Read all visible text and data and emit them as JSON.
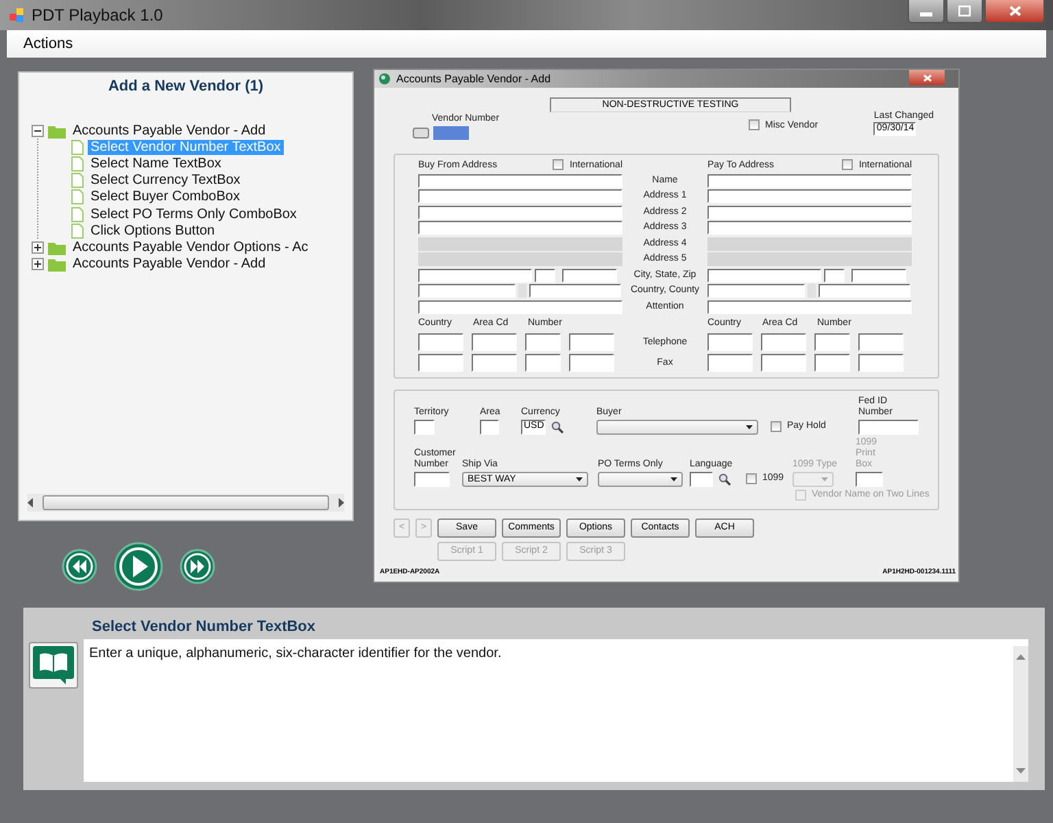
{
  "window": {
    "title": "PDT Playback 1.0"
  },
  "menu": [
    {
      "label": "Actions"
    }
  ],
  "tree_panel": {
    "title": "Add a New Vendor (1)",
    "items": [
      {
        "label": "Accounts Payable Vendor - Add",
        "expanded": true,
        "selected": false,
        "children": [
          {
            "label": "Select Vendor Number TextBox",
            "selected": true
          },
          {
            "label": "Select Name TextBox",
            "selected": false
          },
          {
            "label": "Select Currency TextBox",
            "selected": false
          },
          {
            "label": "Select Buyer ComboBox",
            "selected": false
          },
          {
            "label": "Select PO Terms Only ComboBox",
            "selected": false
          },
          {
            "label": "Click Options Button",
            "selected": false
          }
        ]
      },
      {
        "label": "Accounts Payable Vendor Options - Ac",
        "expanded": false,
        "selected": false
      },
      {
        "label": "Accounts Payable Vendor - Add",
        "expanded": false,
        "selected": false
      }
    ]
  },
  "vendor_form": {
    "title": "Accounts Payable Vendor - Add",
    "company": "NON-DESTRUCTIVE TESTING",
    "vendor_number": {
      "label": "Vendor Number"
    },
    "misc_vendor": {
      "label": "Misc Vendor",
      "checked": false
    },
    "last_changed": {
      "label": "Last Changed",
      "value": "09/30/14"
    },
    "address": {
      "left_title": "Buy From Address",
      "right_title": "Pay To Address",
      "left_international": {
        "label": "International",
        "checked": false
      },
      "right_international": {
        "label": "International",
        "checked": false
      },
      "rows": [
        {
          "label": "Name",
          "kind": "full",
          "disabled": false
        },
        {
          "label": "Address 1",
          "kind": "full",
          "disabled": false
        },
        {
          "label": "Address 2",
          "kind": "full",
          "disabled": false
        },
        {
          "label": "Address 3",
          "kind": "full",
          "disabled": false
        },
        {
          "label": "Address 4",
          "kind": "full",
          "disabled": true
        },
        {
          "label": "Address 5",
          "kind": "full",
          "disabled": true
        },
        {
          "label": "City, State, Zip",
          "kind": "city",
          "disabled": false
        },
        {
          "label": "Country, County",
          "kind": "country",
          "disabled": false
        },
        {
          "label": "Attention",
          "kind": "full",
          "disabled": false
        }
      ],
      "left_phone_columns": [
        "Country",
        "Area Cd",
        "Number"
      ],
      "right_phone_columns": [
        "Country",
        "Area Cd",
        "Number"
      ],
      "phone_rows": [
        "Telephone",
        "Fax"
      ]
    },
    "details": [
      [
        {
          "label": "Territory",
          "kind": "text"
        },
        {
          "label": "Area",
          "kind": "text"
        },
        {
          "label": "Currency",
          "kind": "lookup",
          "value": "USD"
        },
        {
          "label": "Buyer",
          "kind": "combo"
        },
        {
          "label": "Pay Hold",
          "kind": "checkbox",
          "checked": false
        },
        {
          "label": "Fed ID Number",
          "kind": "text"
        }
      ],
      [
        {
          "label": "Customer Number",
          "kind": "text"
        },
        {
          "label": "Ship Via",
          "kind": "combo",
          "value": "BEST WAY"
        },
        {
          "label": "PO Terms Only",
          "kind": "combo"
        },
        {
          "label": "Language",
          "kind": "lookup"
        },
        {
          "label": "1099",
          "kind": "checkbox",
          "checked": false
        },
        {
          "label": "1099 Type",
          "kind": "combo",
          "disabled": true
        },
        {
          "label": "1099 Print Box",
          "kind": "text",
          "disabled": true
        }
      ],
      [
        {
          "label": "Vendor Name on Two Lines",
          "kind": "checkbox",
          "checked": false,
          "disabled": true
        }
      ]
    ],
    "buttons": [
      {
        "label": "<",
        "disabled": true
      },
      {
        "label": ">",
        "disabled": true
      },
      {
        "label": "Save",
        "disabled": false
      },
      {
        "label": "Comments",
        "disabled": false
      },
      {
        "label": "Options",
        "disabled": false
      },
      {
        "label": "Contacts",
        "disabled": false
      },
      {
        "label": "ACH",
        "disabled": false
      }
    ],
    "script_buttons": [
      {
        "label": "Script 1",
        "disabled": true
      },
      {
        "label": "Script 2",
        "disabled": true
      },
      {
        "label": "Script 3",
        "disabled": true
      }
    ],
    "footer_left": "AP1EHD-AP2002A",
    "footer_right": "AP1H2HD-001234.1111"
  },
  "help": {
    "title": "Select Vendor Number TextBox",
    "text": "Enter a unique, alphanumeric, six-character identifier for the vendor."
  }
}
